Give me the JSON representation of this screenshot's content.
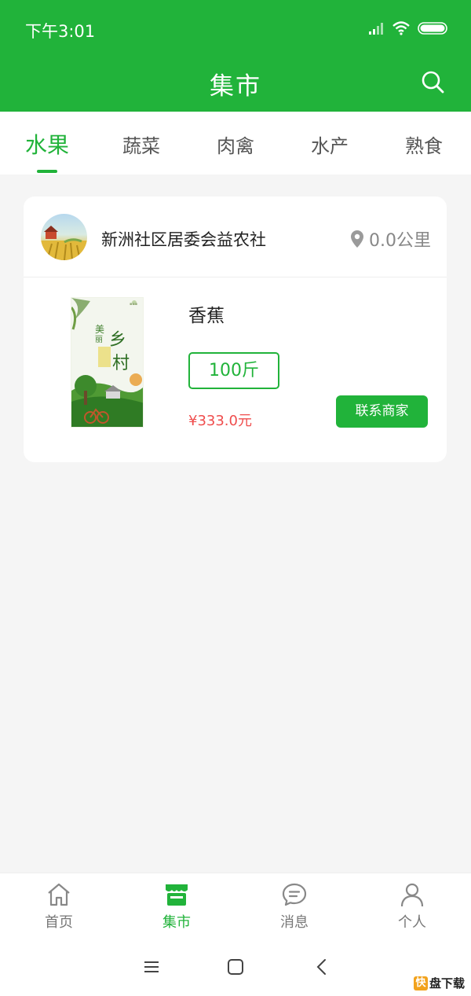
{
  "status_bar": {
    "time": "下午3:01"
  },
  "header": {
    "title": "集市",
    "search_icon": "search-icon"
  },
  "tabs": [
    {
      "label": "水果",
      "active": true
    },
    {
      "label": "蔬菜",
      "active": false
    },
    {
      "label": "肉禽",
      "active": false
    },
    {
      "label": "水产",
      "active": false
    },
    {
      "label": "熟食",
      "active": false
    }
  ],
  "listing": {
    "shop_name": "新洲社区居委会益农社",
    "distance": "0.0公里",
    "product_name": "香蕉",
    "quantity": "100斤",
    "price": "¥333.0元",
    "contact_label": "联系商家",
    "image_caption": "美丽乡村"
  },
  "bottom_nav": [
    {
      "label": "首页",
      "icon": "home-icon",
      "active": false
    },
    {
      "label": "集市",
      "icon": "market-icon",
      "active": true
    },
    {
      "label": "消息",
      "icon": "message-icon",
      "active": false
    },
    {
      "label": "个人",
      "icon": "person-icon",
      "active": false
    }
  ],
  "watermark": {
    "mark": "快",
    "text": "盘下载"
  },
  "colors": {
    "primary": "#21b33a",
    "price": "#ef4d4d",
    "background": "#f5f5f5"
  }
}
